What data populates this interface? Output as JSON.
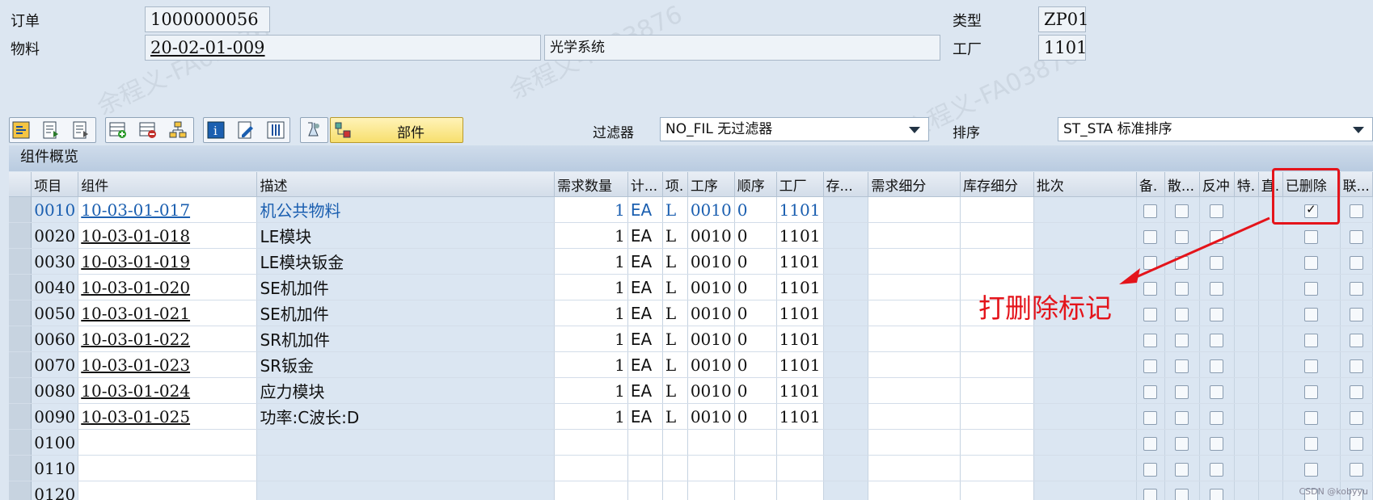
{
  "header": {
    "order_label": "订单",
    "order_value": "1000000056",
    "material_label": "物料",
    "material_value": "20-02-01-009",
    "material_desc": "光学系统",
    "type_label": "类型",
    "type_value": "ZP01",
    "plant_label": "工厂",
    "plant_value": "1101"
  },
  "toolbar": {
    "part_button_label": "部件",
    "filter_label": "过滤器",
    "filter_value": "NO_FIL 无过滤器",
    "sort_label": "排序",
    "sort_value": "ST_STA 标准排序"
  },
  "panel": {
    "title": "组件概览"
  },
  "grid": {
    "columns": [
      "项目",
      "组件",
      "描述",
      "需求数量",
      "计...",
      "项.",
      "工序",
      "顺序",
      "工厂",
      "存...",
      "需求细分",
      "库存细分",
      "批次",
      "备.",
      "散...",
      "反冲",
      "特.",
      "直.",
      "已删除",
      "联..."
    ],
    "rows": [
      {
        "item": "0010",
        "component": "10-03-01-017",
        "desc": "机公共物料",
        "qty": "1",
        "uom": "EA",
        "cat": "L",
        "op": "0010",
        "seq": "0",
        "plant": "1101",
        "deleted": true
      },
      {
        "item": "0020",
        "component": "10-03-01-018",
        "desc": "LE模块",
        "qty": "1",
        "uom": "EA",
        "cat": "L",
        "op": "0010",
        "seq": "0",
        "plant": "1101",
        "deleted": false
      },
      {
        "item": "0030",
        "component": "10-03-01-019",
        "desc": "LE模块钣金",
        "qty": "1",
        "uom": "EA",
        "cat": "L",
        "op": "0010",
        "seq": "0",
        "plant": "1101",
        "deleted": false
      },
      {
        "item": "0040",
        "component": "10-03-01-020",
        "desc": "SE机加件",
        "qty": "1",
        "uom": "EA",
        "cat": "L",
        "op": "0010",
        "seq": "0",
        "plant": "1101",
        "deleted": false
      },
      {
        "item": "0050",
        "component": "10-03-01-021",
        "desc": "SE机加件",
        "qty": "1",
        "uom": "EA",
        "cat": "L",
        "op": "0010",
        "seq": "0",
        "plant": "1101",
        "deleted": false
      },
      {
        "item": "0060",
        "component": "10-03-01-022",
        "desc": "SR机加件",
        "qty": "1",
        "uom": "EA",
        "cat": "L",
        "op": "0010",
        "seq": "0",
        "plant": "1101",
        "deleted": false
      },
      {
        "item": "0070",
        "component": "10-03-01-023",
        "desc": "SR钣金",
        "qty": "1",
        "uom": "EA",
        "cat": "L",
        "op": "0010",
        "seq": "0",
        "plant": "1101",
        "deleted": false
      },
      {
        "item": "0080",
        "component": "10-03-01-024",
        "desc": "应力模块",
        "qty": "1",
        "uom": "EA",
        "cat": "L",
        "op": "0010",
        "seq": "0",
        "plant": "1101",
        "deleted": false
      },
      {
        "item": "0090",
        "component": "10-03-01-025",
        "desc": "功率:C波长:D",
        "qty": "1",
        "uom": "EA",
        "cat": "L",
        "op": "0010",
        "seq": "0",
        "plant": "1101",
        "deleted": false
      },
      {
        "item": "0100",
        "component": "",
        "desc": "",
        "qty": "",
        "uom": "",
        "cat": "",
        "op": "",
        "seq": "",
        "plant": "",
        "deleted": false
      },
      {
        "item": "0110",
        "component": "",
        "desc": "",
        "qty": "",
        "uom": "",
        "cat": "",
        "op": "",
        "seq": "",
        "plant": "",
        "deleted": false
      },
      {
        "item": "0120",
        "component": "",
        "desc": "",
        "qty": "",
        "uom": "",
        "cat": "",
        "op": "",
        "seq": "",
        "plant": "",
        "deleted": false
      }
    ]
  },
  "annotation": {
    "text": "打删除标记",
    "color": "#e4141b"
  },
  "watermark": {
    "text": "余程义-FA03876",
    "corner": "CSDN @kobyyu"
  }
}
